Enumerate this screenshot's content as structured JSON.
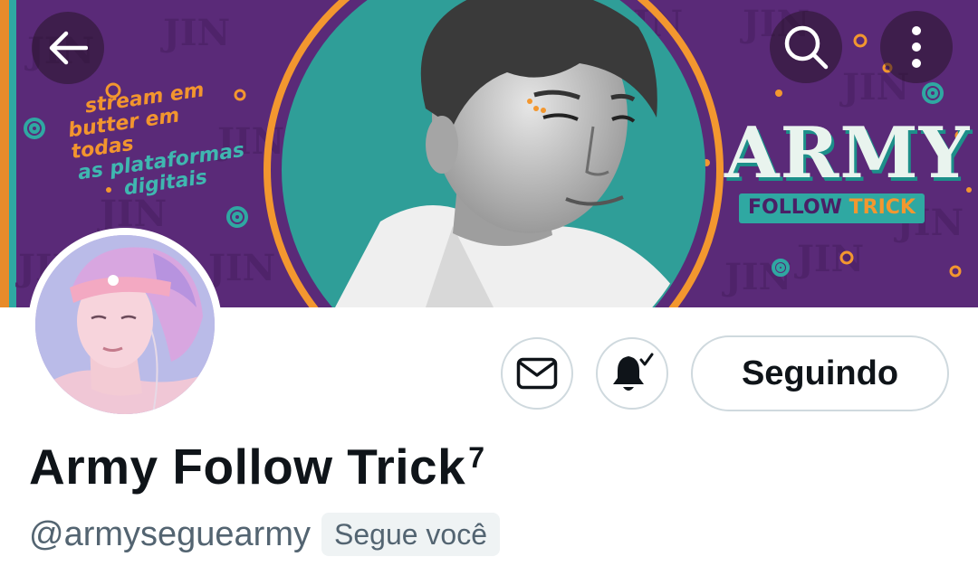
{
  "banner": {
    "promo_line1": "stream em",
    "promo_line2": "butter em todas",
    "promo_line3": "as plataformas",
    "promo_line4": "digitais",
    "watermark": "JIN",
    "brand_title": "ARMY",
    "brand_sub_follow": "FOLLOW ",
    "brand_sub_trick": "TRICK"
  },
  "nav": {
    "back_icon": "arrow-left-icon",
    "search_icon": "search-icon",
    "more_icon": "more-vertical-icon"
  },
  "actions": {
    "message_icon": "envelope-icon",
    "notifications_icon": "bell-check-icon",
    "follow_label": "Seguindo"
  },
  "profile": {
    "display_name": "Army Follow Trick",
    "name_suffix": "7",
    "handle": "@armyseguearmy",
    "follows_you_badge": "Segue você"
  },
  "colors": {
    "banner_purple": "#5a2a78",
    "teal": "#2fa8a2",
    "orange": "#f3972f",
    "text_primary": "#0f1419",
    "text_secondary": "#536471",
    "border": "#cfd9de"
  }
}
